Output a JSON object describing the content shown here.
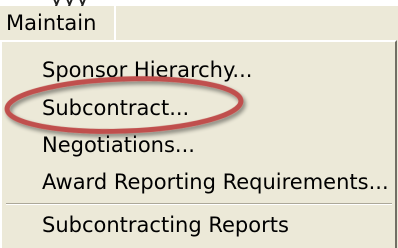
{
  "menubar": {
    "title": "Maintain"
  },
  "backdrop": {
    "partial_text": "yyy"
  },
  "menu": {
    "items": [
      {
        "label": "Sponsor Hierarchy..."
      },
      {
        "label": "Subcontract..."
      },
      {
        "label": "Negotiations..."
      },
      {
        "label": "Award Reporting Requirements..."
      },
      {
        "label": "Subcontracting Reports"
      }
    ]
  },
  "annotation": {
    "highlighted_item": "Subcontract...",
    "ring_color": "#c0504d"
  }
}
